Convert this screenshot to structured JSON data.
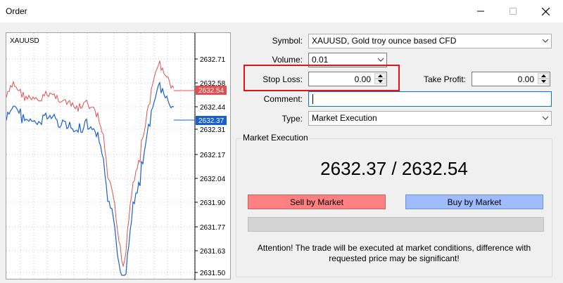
{
  "window": {
    "title": "Order"
  },
  "chart": {
    "symbol": "XAUUSD",
    "price_axis": [
      "2632.71",
      "2632.58",
      "2632.44",
      "2632.31",
      "2632.17",
      "2632.04",
      "2631.90",
      "2631.77",
      "2631.63",
      "2631.50"
    ],
    "ask_tag": "2632.54",
    "bid_tag": "2632.37",
    "colors": {
      "ask": "#e05050",
      "bid": "#1a5fd0",
      "grid": "#c8c8c8"
    }
  },
  "form": {
    "symbol_label": "Symbol:",
    "symbol_value": "XAUUSD, Gold troy ounce based CFD",
    "volume_label": "Volume:",
    "volume_value": "0.01",
    "stop_loss_label": "Stop Loss:",
    "stop_loss_value": "0.00",
    "take_profit_label": "Take Profit:",
    "take_profit_value": "0.00",
    "comment_label": "Comment:",
    "comment_value": "",
    "type_label": "Type:",
    "type_value": "Market Execution"
  },
  "execution": {
    "group_title": "Market Execution",
    "price_display": "2632.37 / 2632.54",
    "sell_label": "Sell by Market",
    "buy_label": "Buy by Market",
    "notice_line1": "Attention! The trade will be executed at market conditions, difference with",
    "notice_line2": "requested price may be significant!"
  }
}
